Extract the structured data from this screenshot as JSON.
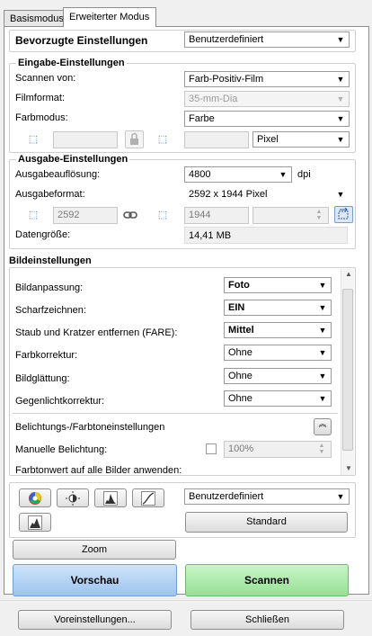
{
  "tabs": {
    "basic": "Basismodus",
    "advanced": "Erweiterter Modus"
  },
  "preferred": {
    "label": "Bevorzugte Einstellungen",
    "value": "Benutzerdefiniert"
  },
  "input": {
    "title": "Eingabe-Einstellungen",
    "scan_from": {
      "label": "Scannen von:",
      "value": "Farb-Positiv-Film"
    },
    "film_format": {
      "label": "Filmformat:",
      "value": "35-mm-Dia"
    },
    "color_mode": {
      "label": "Farbmodus:",
      "value": "Farbe"
    },
    "unit": "Pixel"
  },
  "output": {
    "title": "Ausgabe-Einstellungen",
    "resolution": {
      "label": "Ausgabeauflösung:",
      "value": "4800",
      "unit": "dpi"
    },
    "format": {
      "label": "Ausgabeformat:",
      "value": "2592 x 1944 Pixel"
    },
    "width": "2592",
    "height": "1944",
    "datasize": {
      "label": "Datengröße:",
      "value": "14,41 MB"
    }
  },
  "image": {
    "title": "Bildeinstellungen",
    "rows": [
      {
        "label": "Bildanpassung:",
        "value": "Foto",
        "bold": true
      },
      {
        "label": "Scharfzeichnen:",
        "value": "EIN",
        "bold": true
      },
      {
        "label": "Staub und Kratzer entfernen (FARE):",
        "value": "Mittel",
        "bold": true
      },
      {
        "label": "Farbkorrektur:",
        "value": "Ohne",
        "bold": false
      },
      {
        "label": "Bildglättung:",
        "value": "Ohne",
        "bold": false
      },
      {
        "label": "Gegenlichtkorrektur:",
        "value": "Ohne",
        "bold": false
      }
    ],
    "exposure_title": "Belichtungs-/Farbtoneinstellungen",
    "manual_exposure": {
      "label": "Manuelle Belichtung:",
      "value": "100%"
    },
    "apply_all": "Farbtonwert auf alle Bilder anwenden:"
  },
  "tone": {
    "preset": "Benutzerdefiniert",
    "standard": "Standard"
  },
  "buttons": {
    "zoom": "Zoom",
    "preview": "Vorschau",
    "scan": "Scannen",
    "presets": "Voreinstellungen...",
    "close": "Schließen"
  },
  "icons": [
    "crop-icon",
    "lock-icon",
    "link-icon",
    "rotate-icon",
    "color-wheel-icon",
    "brightness-icon",
    "histogram-icon",
    "curve-icon",
    "levels-icon",
    "collapse-icon"
  ],
  "colors": {
    "preview_bg": "#a9cdf2",
    "scan_bg": "#a5e8a4",
    "panel_border": "#8d8d8d"
  }
}
